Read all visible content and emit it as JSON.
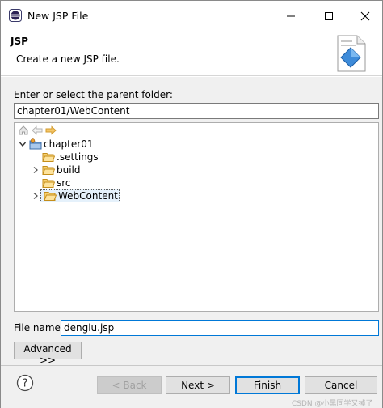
{
  "window": {
    "title": "New JSP File",
    "controls": [
      "minimize",
      "maximize",
      "close"
    ]
  },
  "banner": {
    "title": "JSP",
    "description": "Create a new JSP file."
  },
  "parent_folder": {
    "label": "Enter or select the parent folder:",
    "value": "chapter01/WebContent"
  },
  "tree": {
    "toolbar_icons": [
      "home-icon",
      "back-arrow-icon",
      "forward-arrow-icon"
    ],
    "items": [
      {
        "label": "chapter01",
        "level": 0,
        "expanded": true,
        "icon": "project-icon"
      },
      {
        "label": ".settings",
        "level": 1,
        "expanded": null,
        "icon": "folder-icon"
      },
      {
        "label": "build",
        "level": 1,
        "expanded": false,
        "icon": "folder-icon"
      },
      {
        "label": "src",
        "level": 1,
        "expanded": null,
        "icon": "folder-icon"
      },
      {
        "label": "WebContent",
        "level": 1,
        "expanded": false,
        "icon": "folder-open-icon",
        "selected": true
      }
    ]
  },
  "file_name": {
    "label": "File name:",
    "value": "denglu.jsp"
  },
  "advanced": {
    "label": "Advanced >>"
  },
  "buttons": {
    "back": "< Back",
    "next": "Next >",
    "finish": "Finish",
    "cancel": "Cancel"
  },
  "watermark": "CSDN @小黑同学又掉了",
  "colors": {
    "accent": "#0078d7",
    "folder": "#e8b53c",
    "selection": "#e5f1fb"
  }
}
